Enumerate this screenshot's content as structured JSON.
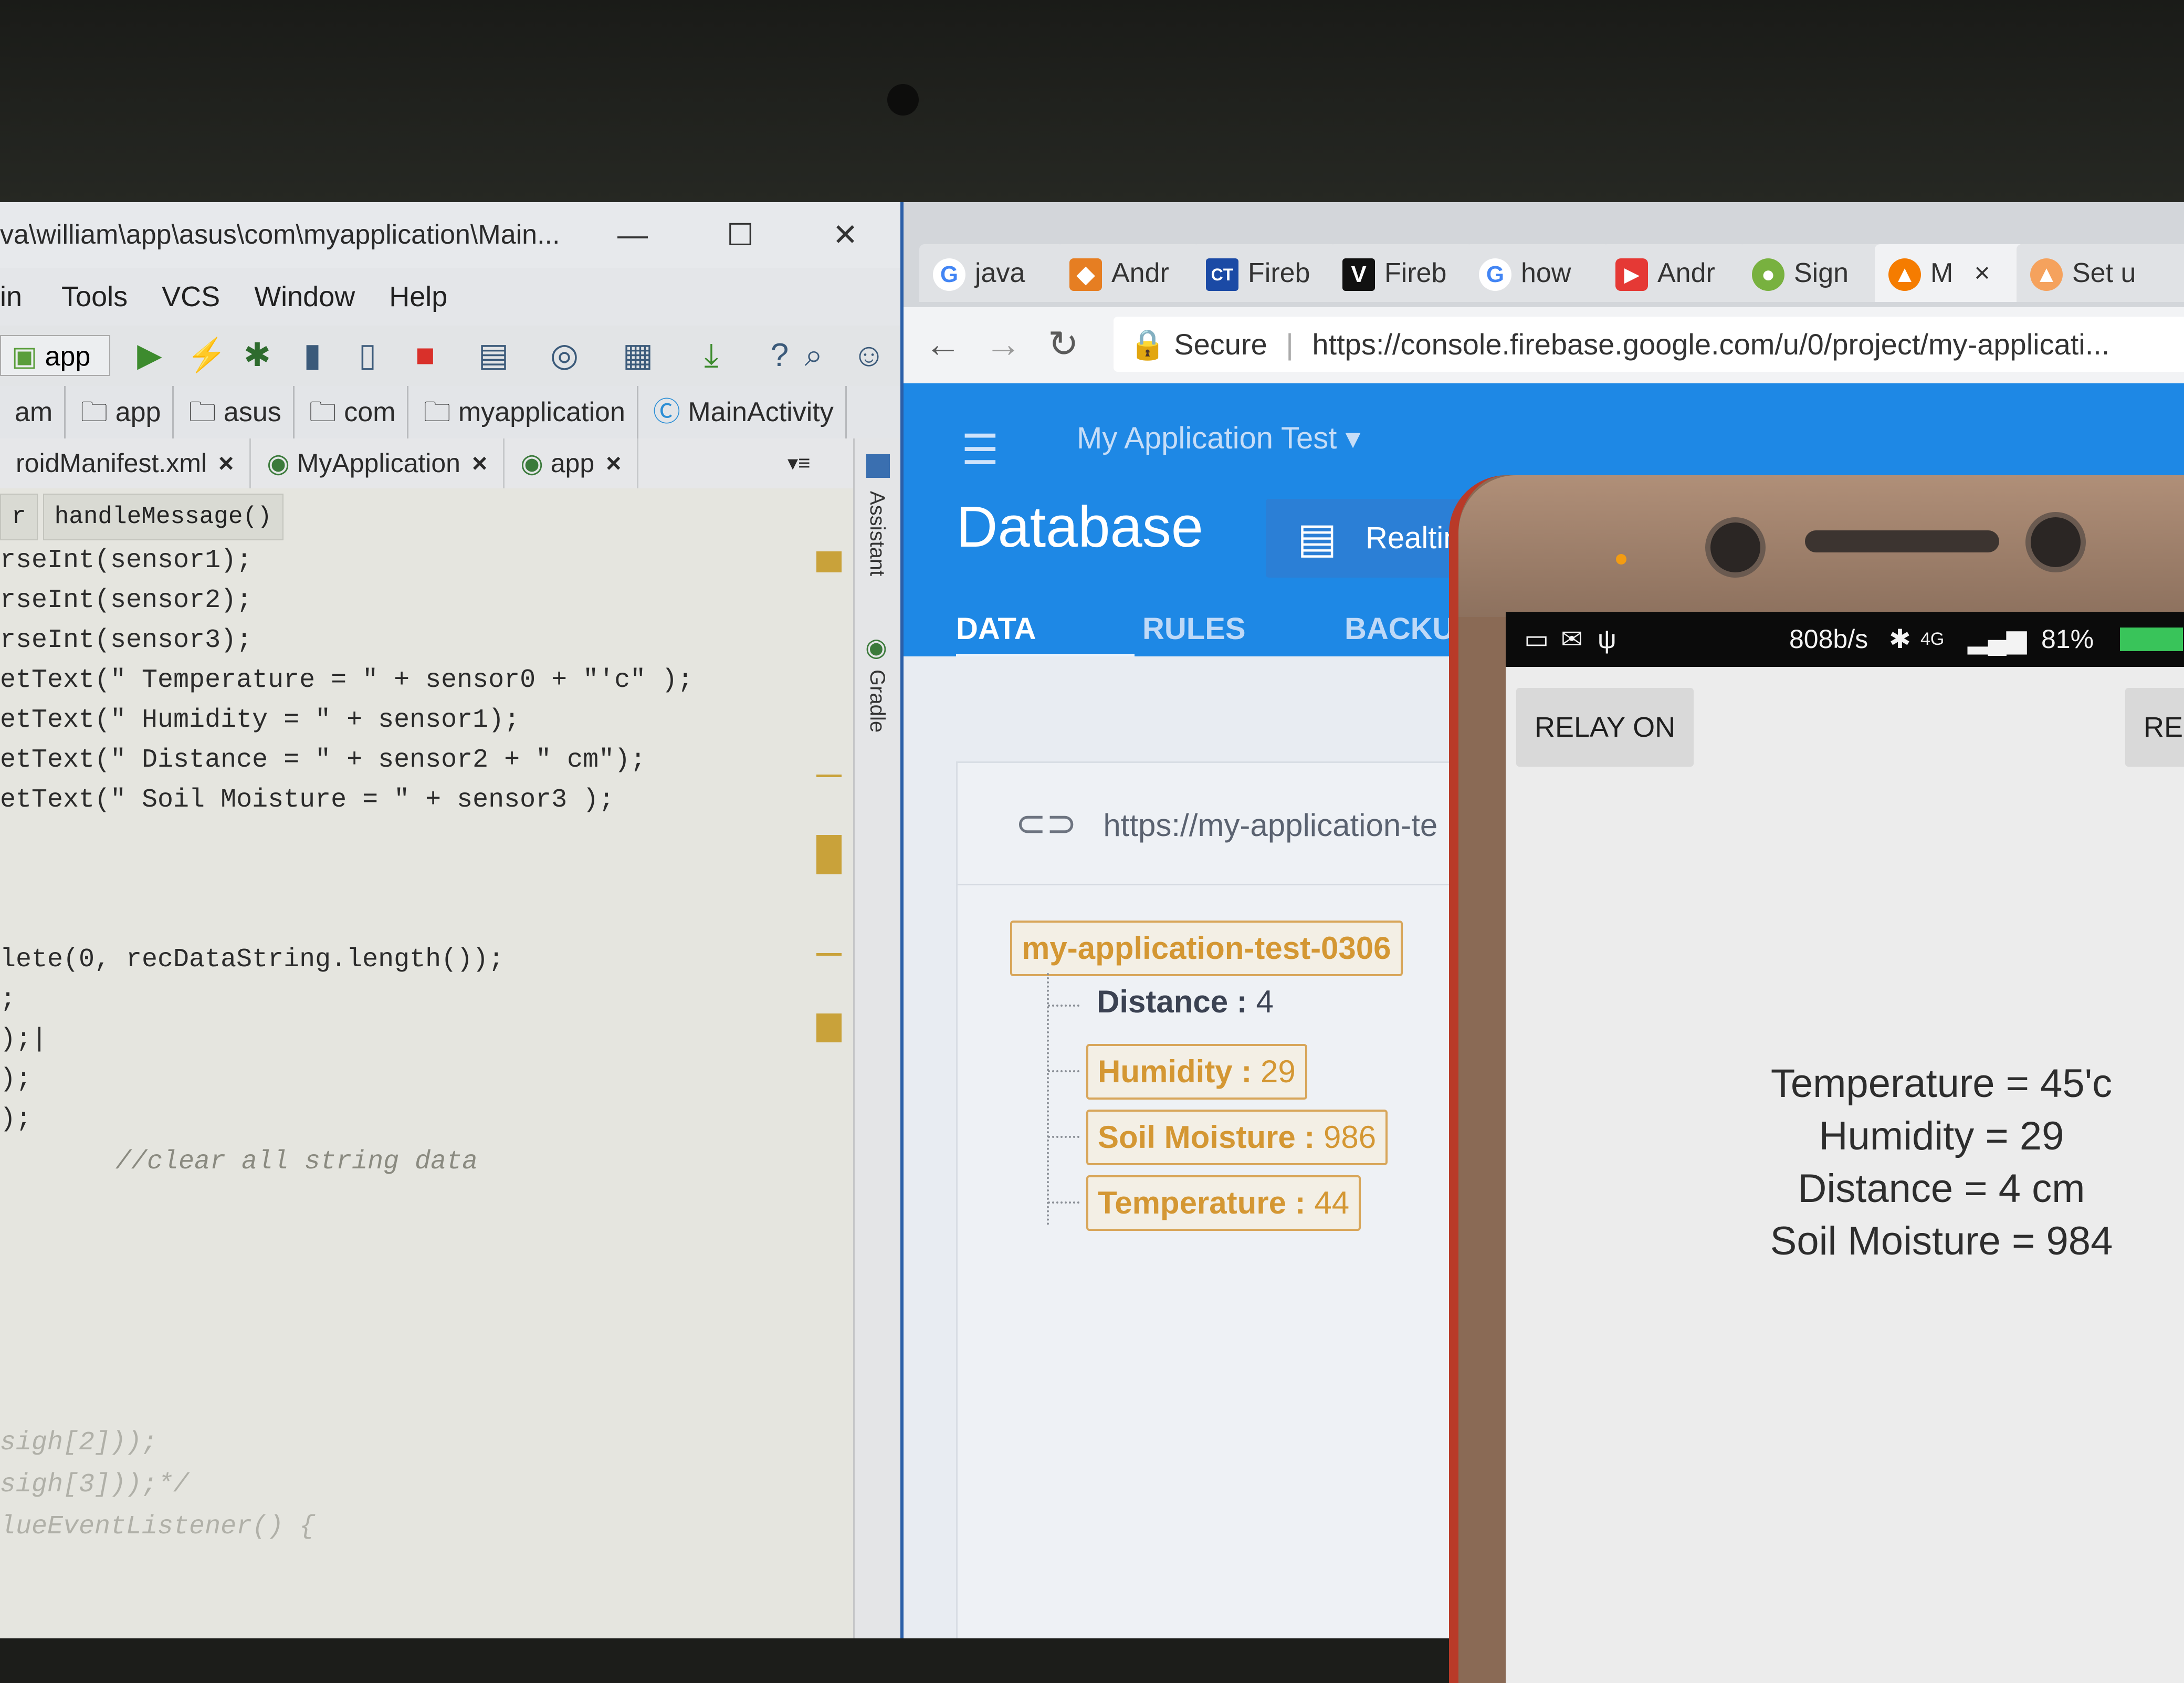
{
  "ide": {
    "title": "va\\william\\app\\asus\\com\\myapplication\\Main...",
    "menu": [
      "in",
      "Tools",
      "VCS",
      "Window",
      "Help"
    ],
    "run_config": "app",
    "breadcrumbs": [
      "am",
      "app",
      "asus",
      "com",
      "myapplication",
      "MainActivity"
    ],
    "tabs": [
      {
        "label": "roidManifest.xml",
        "close": "×"
      },
      {
        "label": "MyApplication",
        "close": "×"
      },
      {
        "label": "app",
        "close": "×"
      }
    ],
    "side_labels": [
      "Assistant",
      "Gradle"
    ],
    "method_crumb": [
      "r",
      "handleMessage()"
    ],
    "code_lines": [
      "rseInt(sensor1);",
      "rseInt(sensor2);",
      "rseInt(sensor3);",
      "etText(\" Temperature = \" + sensor0 + \"'c\" );",
      "etText(\" Humidity = \" + sensor1);",
      "etText(\" Distance = \" + sensor2 + \" cm\");",
      "etText(\" Soil Moisture = \" + sensor3 );",
      "lete(0, recDataString.length());",
      ";",
      ");|",
      ");",
      ");"
    ],
    "comment": "//clear all string data",
    "faded_lines": [
      "sigh[2]));",
      "sigh[3]));*/",
      "lueEventListener() {"
    ]
  },
  "browser": {
    "tabs": [
      {
        "icon": "G",
        "label": "java",
        "color": "#4285f4"
      },
      {
        "icon": "◆",
        "label": "Andr",
        "color": "#e67e22"
      },
      {
        "icon": "CT",
        "label": "Fireb",
        "color": "#1b4aa5"
      },
      {
        "icon": "V",
        "label": "Fireb",
        "color": "#111111"
      },
      {
        "icon": "G",
        "label": "how",
        "color": "#4285f4"
      },
      {
        "icon": "▶",
        "label": "Andr",
        "color": "#e53935"
      },
      {
        "icon": "●",
        "label": "Sign",
        "color": "#78b13f"
      },
      {
        "icon": "▲",
        "label": "M",
        "color": "#f57c00",
        "close": "×"
      },
      {
        "icon": "▲",
        "label": "Set u",
        "color": "#f5a25d"
      }
    ],
    "secure_label": "Secure",
    "url": "https://console.firebase.google.com/u/0/project/my-applicati...",
    "project_name": "My Application Test",
    "page_title": "Database",
    "db_type": "Realtim",
    "nav_tabs": [
      "DATA",
      "RULES",
      "BACKU"
    ],
    "db_url": "https://my-application-te",
    "root_node": "my-application-test-0306",
    "children": [
      {
        "key": "Distance",
        "value": "4",
        "highlighted": false
      },
      {
        "key": "Humidity",
        "value": "29",
        "highlighted": true
      },
      {
        "key": "Soil Moisture",
        "value": "986",
        "highlighted": true
      },
      {
        "key": "Temperature",
        "value": "44",
        "highlighted": true
      }
    ]
  },
  "phone": {
    "net_speed": "808b/s",
    "signal": "4G",
    "battery": "81%",
    "relay_on_label": "RELAY ON",
    "relay_off_label": "REL",
    "readings": [
      "Temperature = 45'c",
      "Humidity = 29",
      "Distance = 4 cm",
      "Soil Moisture = 984"
    ]
  }
}
